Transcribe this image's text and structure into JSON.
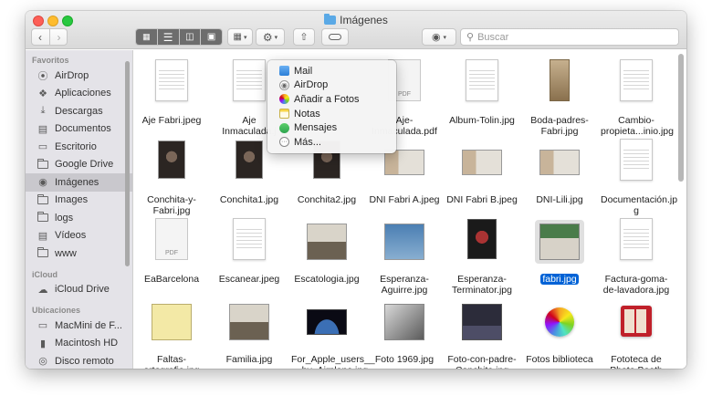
{
  "window": {
    "title": "Imágenes"
  },
  "toolbar": {
    "back_icon": "chevron-left-icon",
    "forward_icon": "chevron-right-icon",
    "search_placeholder": "Buscar"
  },
  "sidebar": {
    "sections": [
      {
        "title": "Favoritos",
        "items": [
          {
            "label": "AirDrop",
            "icon": "airdrop-icon"
          },
          {
            "label": "Aplicaciones",
            "icon": "applications-icon"
          },
          {
            "label": "Descargas",
            "icon": "downloads-icon"
          },
          {
            "label": "Documentos",
            "icon": "documents-icon"
          },
          {
            "label": "Escritorio",
            "icon": "desktop-icon"
          },
          {
            "label": "Google Drive",
            "icon": "folder-icon"
          },
          {
            "label": "Imágenes",
            "icon": "pictures-icon",
            "selected": true
          },
          {
            "label": "Images",
            "icon": "folder-icon"
          },
          {
            "label": "logs",
            "icon": "folder-icon"
          },
          {
            "label": "Vídeos",
            "icon": "movies-icon"
          },
          {
            "label": "www",
            "icon": "folder-icon"
          }
        ]
      },
      {
        "title": "iCloud",
        "items": [
          {
            "label": "iCloud Drive",
            "icon": "icloud-icon"
          }
        ]
      },
      {
        "title": "Ubicaciones",
        "items": [
          {
            "label": "MacMini de F...",
            "icon": "computer-icon"
          },
          {
            "label": "Macintosh HD",
            "icon": "disk-icon"
          },
          {
            "label": "Disco remoto",
            "icon": "remote-disc-icon"
          }
        ]
      }
    ]
  },
  "share_menu": {
    "items": [
      {
        "label": "Mail",
        "icon": "mail-icon"
      },
      {
        "label": "AirDrop",
        "icon": "airdrop-icon"
      },
      {
        "label": "Añadir a Fotos",
        "icon": "photos-icon"
      },
      {
        "label": "Notas",
        "icon": "notes-icon"
      },
      {
        "label": "Mensajes",
        "icon": "messages-icon"
      },
      {
        "label": "Más...",
        "icon": "more-icon"
      }
    ]
  },
  "files": [
    {
      "line1": "Aje Fabri.jpeg",
      "line2": "",
      "kind": "doc"
    },
    {
      "line1": "Aje",
      "line2": "Inmaculada.j",
      "kind": "doc"
    },
    {
      "line1": "",
      "line2": "",
      "kind": "hidden"
    },
    {
      "line1": "Aje-",
      "line2": "Inmaculada.pdf",
      "kind": "pdf"
    },
    {
      "line1": "Album-Tolin.jpg",
      "line2": "",
      "kind": "doc"
    },
    {
      "line1": "Boda-padres-",
      "line2": "Fabri.jpg",
      "kind": "photo-sepia"
    },
    {
      "line1": "Cambio-",
      "line2": "propieta...inio.jpg",
      "kind": "doc"
    },
    {
      "line1": "Conchita-y-",
      "line2": "Fabri.jpg",
      "kind": "photo-dark"
    },
    {
      "line1": "Conchita1.jpg",
      "line2": "",
      "kind": "photo-dark"
    },
    {
      "line1": "Conchita2.jpg",
      "line2": "",
      "kind": "photo-dark"
    },
    {
      "line1": "DNI Fabri A.jpeg",
      "line2": "",
      "kind": "photo-id"
    },
    {
      "line1": "DNI Fabri B.jpeg",
      "line2": "",
      "kind": "photo-id"
    },
    {
      "line1": "DNI-Lili.jpg",
      "line2": "",
      "kind": "photo-id"
    },
    {
      "line1": "Documentación.jp",
      "line2": "g",
      "kind": "doc"
    },
    {
      "line1": "EaBarcelona",
      "line2": "",
      "kind": "pdf"
    },
    {
      "line1": "Escanear.jpeg",
      "line2": "",
      "kind": "doc"
    },
    {
      "line1": "Escatologia.jpg",
      "line2": "",
      "kind": "photo-group"
    },
    {
      "line1": "Esperanza-",
      "line2": "Aguirre.jpg",
      "kind": "photo-eagle"
    },
    {
      "line1": "Esperanza-",
      "line2": "Terminator.jpg",
      "kind": "photo-poster"
    },
    {
      "line1": "fabri.jpg",
      "line2": "",
      "kind": "photo-man",
      "selected": true
    },
    {
      "line1": "Factura-goma-",
      "line2": "de-lavadora.jpg",
      "kind": "doc"
    },
    {
      "line1": "Faltas-",
      "line2": "ortografia.jpg",
      "kind": "photo-text"
    },
    {
      "line1": "Familia.jpg",
      "line2": "",
      "kind": "photo-group"
    },
    {
      "line1": "For_Apple_users__",
      "line2": "__by_Airplane.jpg",
      "kind": "photo-earth"
    },
    {
      "line1": "Foto 1969.jpg",
      "line2": "",
      "kind": "photo-bw"
    },
    {
      "line1": "Foto-con-padre-",
      "line2": "Conchita.jpg",
      "kind": "photo-team"
    },
    {
      "line1": "Fotos biblioteca",
      "line2": "",
      "kind": "photos-app"
    },
    {
      "line1": "Fototeca de",
      "line2": "Photo Booth",
      "kind": "photobooth"
    }
  ]
}
